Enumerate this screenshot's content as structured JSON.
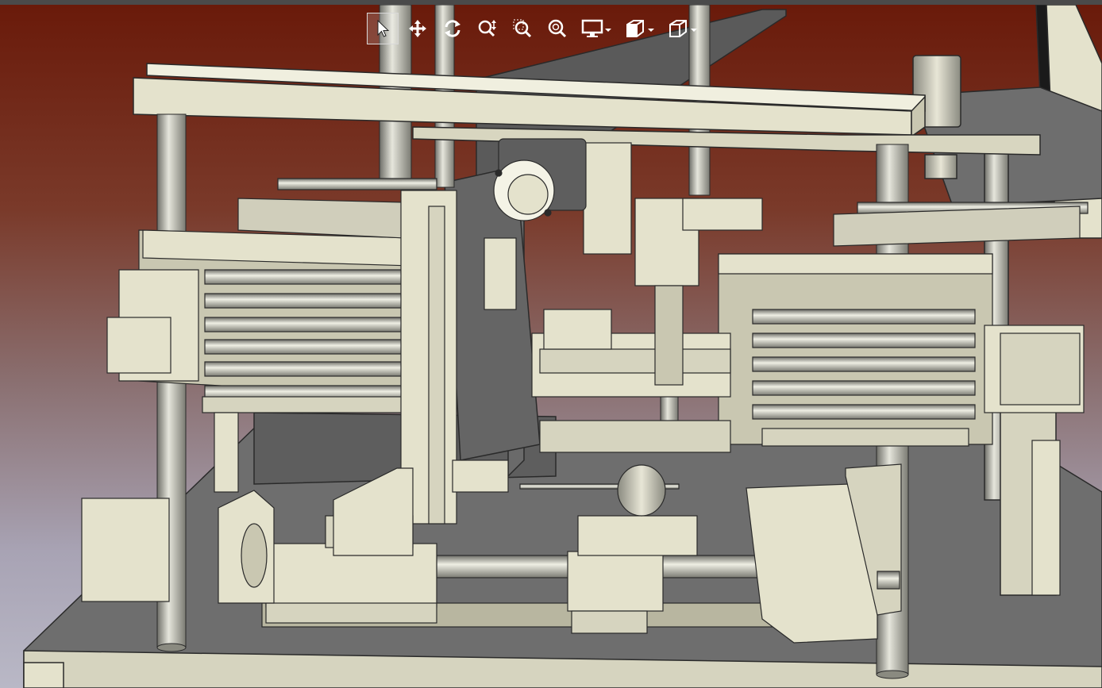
{
  "window": {
    "title": ""
  },
  "toolbar": {
    "items": [
      {
        "name": "select",
        "icon": "cursor-arrow-icon",
        "active": true
      },
      {
        "name": "pan",
        "icon": "move-arrows-icon"
      },
      {
        "name": "rotate",
        "icon": "rotate-icon"
      },
      {
        "name": "zoom",
        "icon": "zoom-updown-icon"
      },
      {
        "name": "zoom-window",
        "icon": "zoom-window-icon"
      },
      {
        "name": "zoom-fit",
        "icon": "zoom-fit-icon"
      },
      {
        "name": "display-mode",
        "icon": "monitor-icon",
        "dropdown": true
      },
      {
        "name": "section-view",
        "icon": "section-cube-icon",
        "dropdown": true
      },
      {
        "name": "view-orientation",
        "icon": "cube-icon",
        "dropdown": true
      }
    ]
  },
  "colors": {
    "part_face": "#e4e2cc",
    "part_shadow": "#b8b6a0",
    "part_edge": "#2a2a2a",
    "base_plate": "#6e6e6e",
    "steel_rod": "#a8a8a0",
    "background_top": "#6a1a0a",
    "background_bottom": "#b9b8c6",
    "toolbar_icon": "#ffffff"
  }
}
